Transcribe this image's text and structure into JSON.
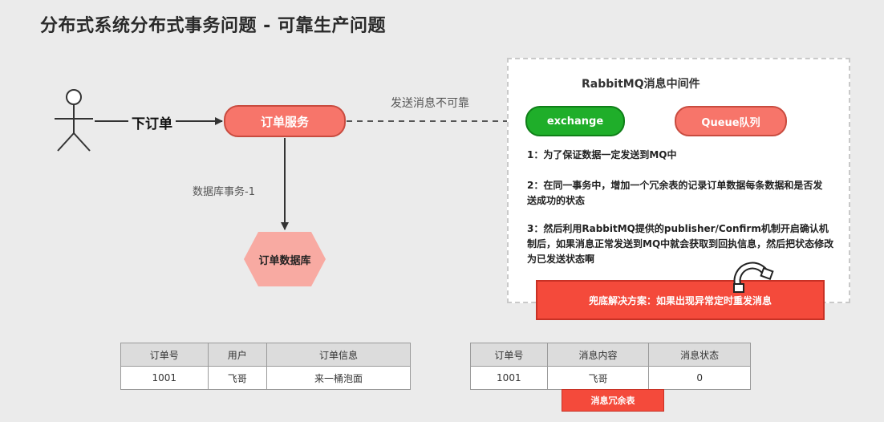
{
  "title": "分布式系统分布式事务问题 - 可靠生产问题",
  "actor_label": "下订单",
  "order_service": "订单服务",
  "unreliable_send": "发送消息不可靠",
  "db_transaction": "数据库事务-1",
  "order_db": "订单数据库",
  "mq_panel": {
    "title": "RabbitMQ消息中间件",
    "exchange": "exchange",
    "queue": "Queue队列",
    "notes": [
      "1：为了保证数据一定发送到MQ中",
      "2：在同一事务中，增加一个冗余表的记录订单数据每条数据和是否发送成功的状态",
      "3：然后利用RabbitMQ提供的publisher/Confirm机制开启确认机制后，如果消息正常发送到MQ中就会获取到回执信息，然后把状态修改为已发送状态啊"
    ],
    "fallback": "兜底解决方案：如果出现异常定时重发消息"
  },
  "order_table": {
    "headers": [
      "订单号",
      "用户",
      "订单信息"
    ],
    "rows": [
      [
        "1001",
        "飞哥",
        "来一桶泡面"
      ]
    ]
  },
  "message_table": {
    "headers": [
      "订单号",
      "消息内容",
      "消息状态"
    ],
    "rows": [
      [
        "1001",
        "飞哥",
        "0"
      ]
    ],
    "caption": "消息冗余表"
  },
  "colors": {
    "service_fill": "#f7756a",
    "exchange_fill": "#1fae2a",
    "alert_fill": "#f44a3b"
  }
}
